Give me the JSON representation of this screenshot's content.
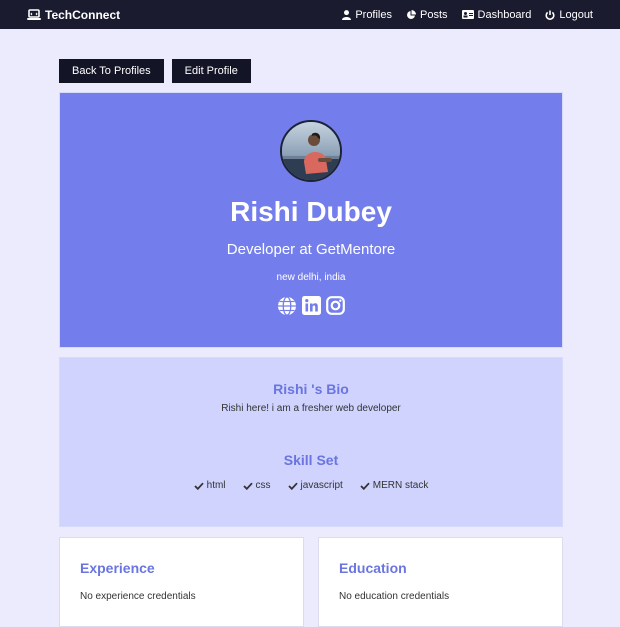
{
  "navbar": {
    "brand": "TechConnect",
    "links": [
      {
        "label": "Profiles",
        "icon": "user-icon"
      },
      {
        "label": "Posts",
        "icon": "pie-chart-icon"
      },
      {
        "label": "Dashboard",
        "icon": "id-card-icon"
      },
      {
        "label": "Logout",
        "icon": "power-icon"
      }
    ]
  },
  "actions": {
    "back_label": "Back To Profiles",
    "edit_label": "Edit Profile"
  },
  "profile": {
    "name": "Rishi Dubey",
    "status": "Developer at GetMentore",
    "location": "new delhi, india",
    "socials": [
      "globe-icon",
      "linkedin-icon",
      "instagram-icon"
    ]
  },
  "bio": {
    "title": "Rishi 's Bio",
    "text": "Rishi here! i am a fresher web developer",
    "skills_title": "Skill Set",
    "skills": [
      "html",
      "css",
      "javascript",
      "MERN stack"
    ]
  },
  "experience": {
    "title": "Experience",
    "empty_text": "No experience credentials"
  },
  "education": {
    "title": "Education",
    "empty_text": "No education credentials"
  },
  "colors": {
    "navbar_bg": "#1a1b2e",
    "page_bg": "#ebebfd",
    "accent": "#737eec",
    "bio_bg": "#cfd3fd",
    "heading": "#6a75e0"
  }
}
